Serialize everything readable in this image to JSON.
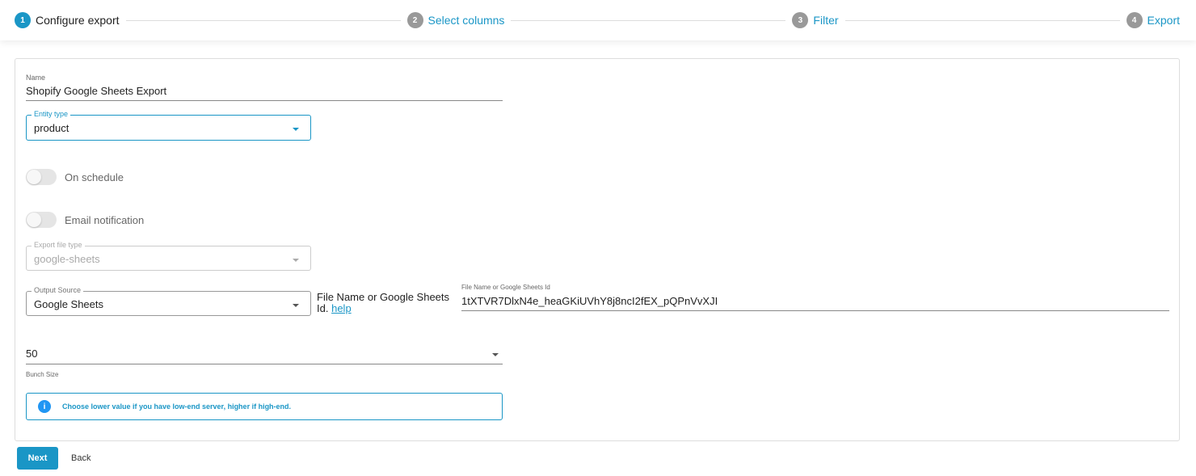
{
  "stepper": {
    "steps": [
      {
        "num": "1",
        "label": "Configure export",
        "active": true
      },
      {
        "num": "2",
        "label": "Select columns"
      },
      {
        "num": "3",
        "label": "Filter"
      },
      {
        "num": "4",
        "label": "Export"
      }
    ]
  },
  "form": {
    "name": {
      "label": "Name",
      "value": "Shopify Google Sheets Export"
    },
    "entity_type": {
      "label": "Entity type",
      "value": "product"
    },
    "on_schedule": {
      "label": "On schedule",
      "on": false
    },
    "email_notification": {
      "label": "Email notification",
      "on": false
    },
    "export_file_type": {
      "label": "Export file type",
      "value": "google-sheets"
    },
    "output_source": {
      "label": "Output Source",
      "value": "Google Sheets"
    },
    "file_name_hint": {
      "text": "File Name or Google Sheets Id.",
      "link": "help"
    },
    "file_id": {
      "label": "File Name or Google Sheets Id",
      "value": "1tXTVR7DlxN4e_heaGKiUVhY8j8ncI2fEX_pQPnVvXJI"
    },
    "bunch_size": {
      "label": "Bunch Size",
      "value": "50"
    },
    "info": "Choose lower value if you have low-end server, higher if high-end."
  },
  "actions": {
    "next": "Next",
    "back": "Back"
  },
  "colors": {
    "accent": "#1a96c6",
    "inactive_step": "#999999"
  }
}
